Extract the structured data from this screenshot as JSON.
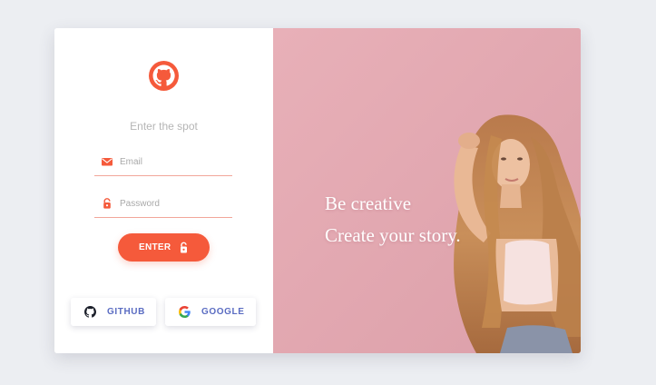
{
  "login": {
    "tagline": "Enter the spot",
    "email_placeholder": "Email",
    "password_placeholder": "Password",
    "enter_label": "ENTER",
    "social": {
      "github_label": "GITHUB",
      "google_label": "GOOGLE"
    }
  },
  "hero": {
    "line1": "Be creative",
    "line2": "Create your story."
  },
  "icons": {
    "logo": "github-logo-icon",
    "email": "envelope-icon",
    "password": "lock-icon",
    "enter": "lock-icon",
    "github": "github-icon",
    "google": "google-icon"
  },
  "colors": {
    "accent": "#f55a3b",
    "field_underline": "#f2a69a",
    "social_text": "#5a6cc2",
    "hero_background": "#e3a9b2",
    "page_background": "#eceef2"
  }
}
